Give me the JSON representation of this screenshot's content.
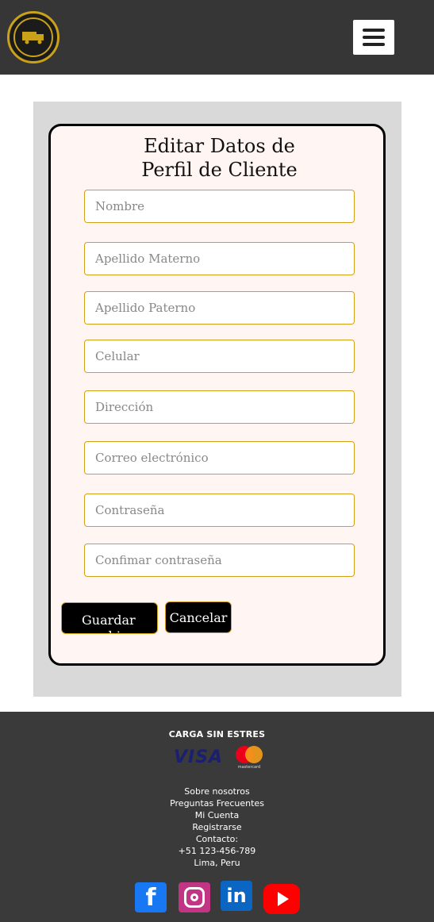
{
  "header": {
    "logo_text": "CARGA SIN ESTRES",
    "menu_icon": "hamburger-menu-icon"
  },
  "form": {
    "title_line1": "Editar Datos de",
    "title_line2": "Perfil de Cliente",
    "fields": [
      {
        "placeholder": "Nombre"
      },
      {
        "placeholder": "Apellido Materno"
      },
      {
        "placeholder": "Apellido Paterno"
      },
      {
        "placeholder": "Celular"
      },
      {
        "placeholder": "Dirección"
      },
      {
        "placeholder": "Correo electrónico"
      },
      {
        "placeholder": "Contraseña"
      },
      {
        "placeholder": "Confimar contraseña"
      }
    ],
    "save_label": "Guardar cambios",
    "cancel_label": "Cancelar"
  },
  "footer": {
    "brand": "CARGA SIN ESTRES",
    "payments": {
      "visa": "VISA",
      "mastercard": "mastercard"
    },
    "links": {
      "about": "Sobre nosotros",
      "faq": "Preguntas Frecuentes",
      "account": "Mi Cuenta",
      "register": "Registrarse",
      "contact_label": "Contacto:",
      "phone": "+51 123-456-789",
      "location": "Lima, Peru"
    },
    "social": {
      "facebook": "f",
      "linkedin": "in"
    }
  },
  "colors": {
    "header_bg": "#363636",
    "accent": "#d4a017",
    "card_bg": "#fff6f4",
    "footer_bg": "#3a3a3a"
  }
}
